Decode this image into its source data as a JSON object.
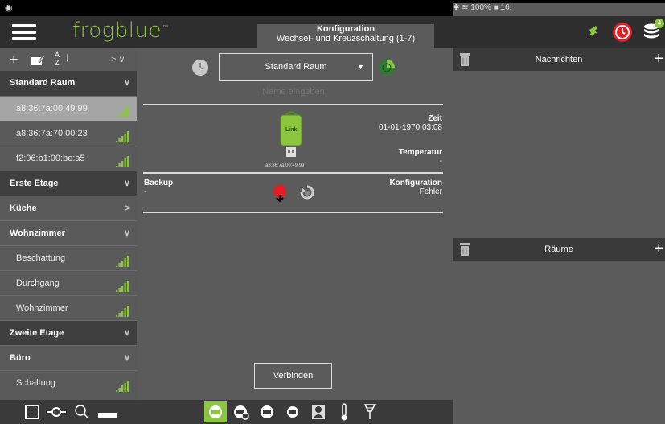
{
  "statusbar": {
    "left_icon": "android-icon",
    "right_text": "100% ■ 16:"
  },
  "header": {
    "logo": "frogblue",
    "logo_tm": "™",
    "title": "Konfiguration",
    "subtitle": "Wechsel- und Kreuzschaltung (1-7)",
    "badge": "4",
    "colors": {
      "brand": "#8cc63f",
      "alert": "#e31e24"
    }
  },
  "sidebar": {
    "sort_label_top": "A",
    "sort_label_bottom": "Z",
    "expand_label": "> ∨",
    "rows": [
      {
        "type": "group",
        "label": "Standard Raum"
      },
      {
        "type": "dev",
        "label": "a8:36:7a:00:49:99",
        "selected": true
      },
      {
        "type": "dev",
        "label": "a8:36:7a:70:00:23"
      },
      {
        "type": "dev",
        "label": "f2:06:b1:00:be:a5"
      },
      {
        "type": "group",
        "label": "Erste Etage"
      },
      {
        "type": "sub",
        "label": "Küche"
      },
      {
        "type": "sub",
        "label": "Wohnzimmer"
      },
      {
        "type": "dev",
        "label": "Beschattung"
      },
      {
        "type": "dev",
        "label": "Durchgang"
      },
      {
        "type": "dev",
        "label": "Wohnzimmer"
      },
      {
        "type": "group",
        "label": "Zweite Etage"
      },
      {
        "type": "sub",
        "label": "Büro"
      },
      {
        "type": "dev",
        "label": "Schaltung"
      }
    ]
  },
  "main": {
    "room_select": "Standard Raum",
    "name_placeholder": "Name eingeben",
    "device_label": "Link",
    "device_mac": "a8:36:7a:00:49:99",
    "zeit_label": "Zeit",
    "zeit_value": "01-01-1970 03:08",
    "temp_label": "Temperatur",
    "temp_value": "-",
    "backup_label": "Backup",
    "backup_value": "-",
    "config_label": "Konfiguration",
    "config_value": "Fehler",
    "connect_button": "Verbinden"
  },
  "right": {
    "messages_title": "Nachrichten",
    "rooms_title": "Räume",
    "plus": "+"
  }
}
